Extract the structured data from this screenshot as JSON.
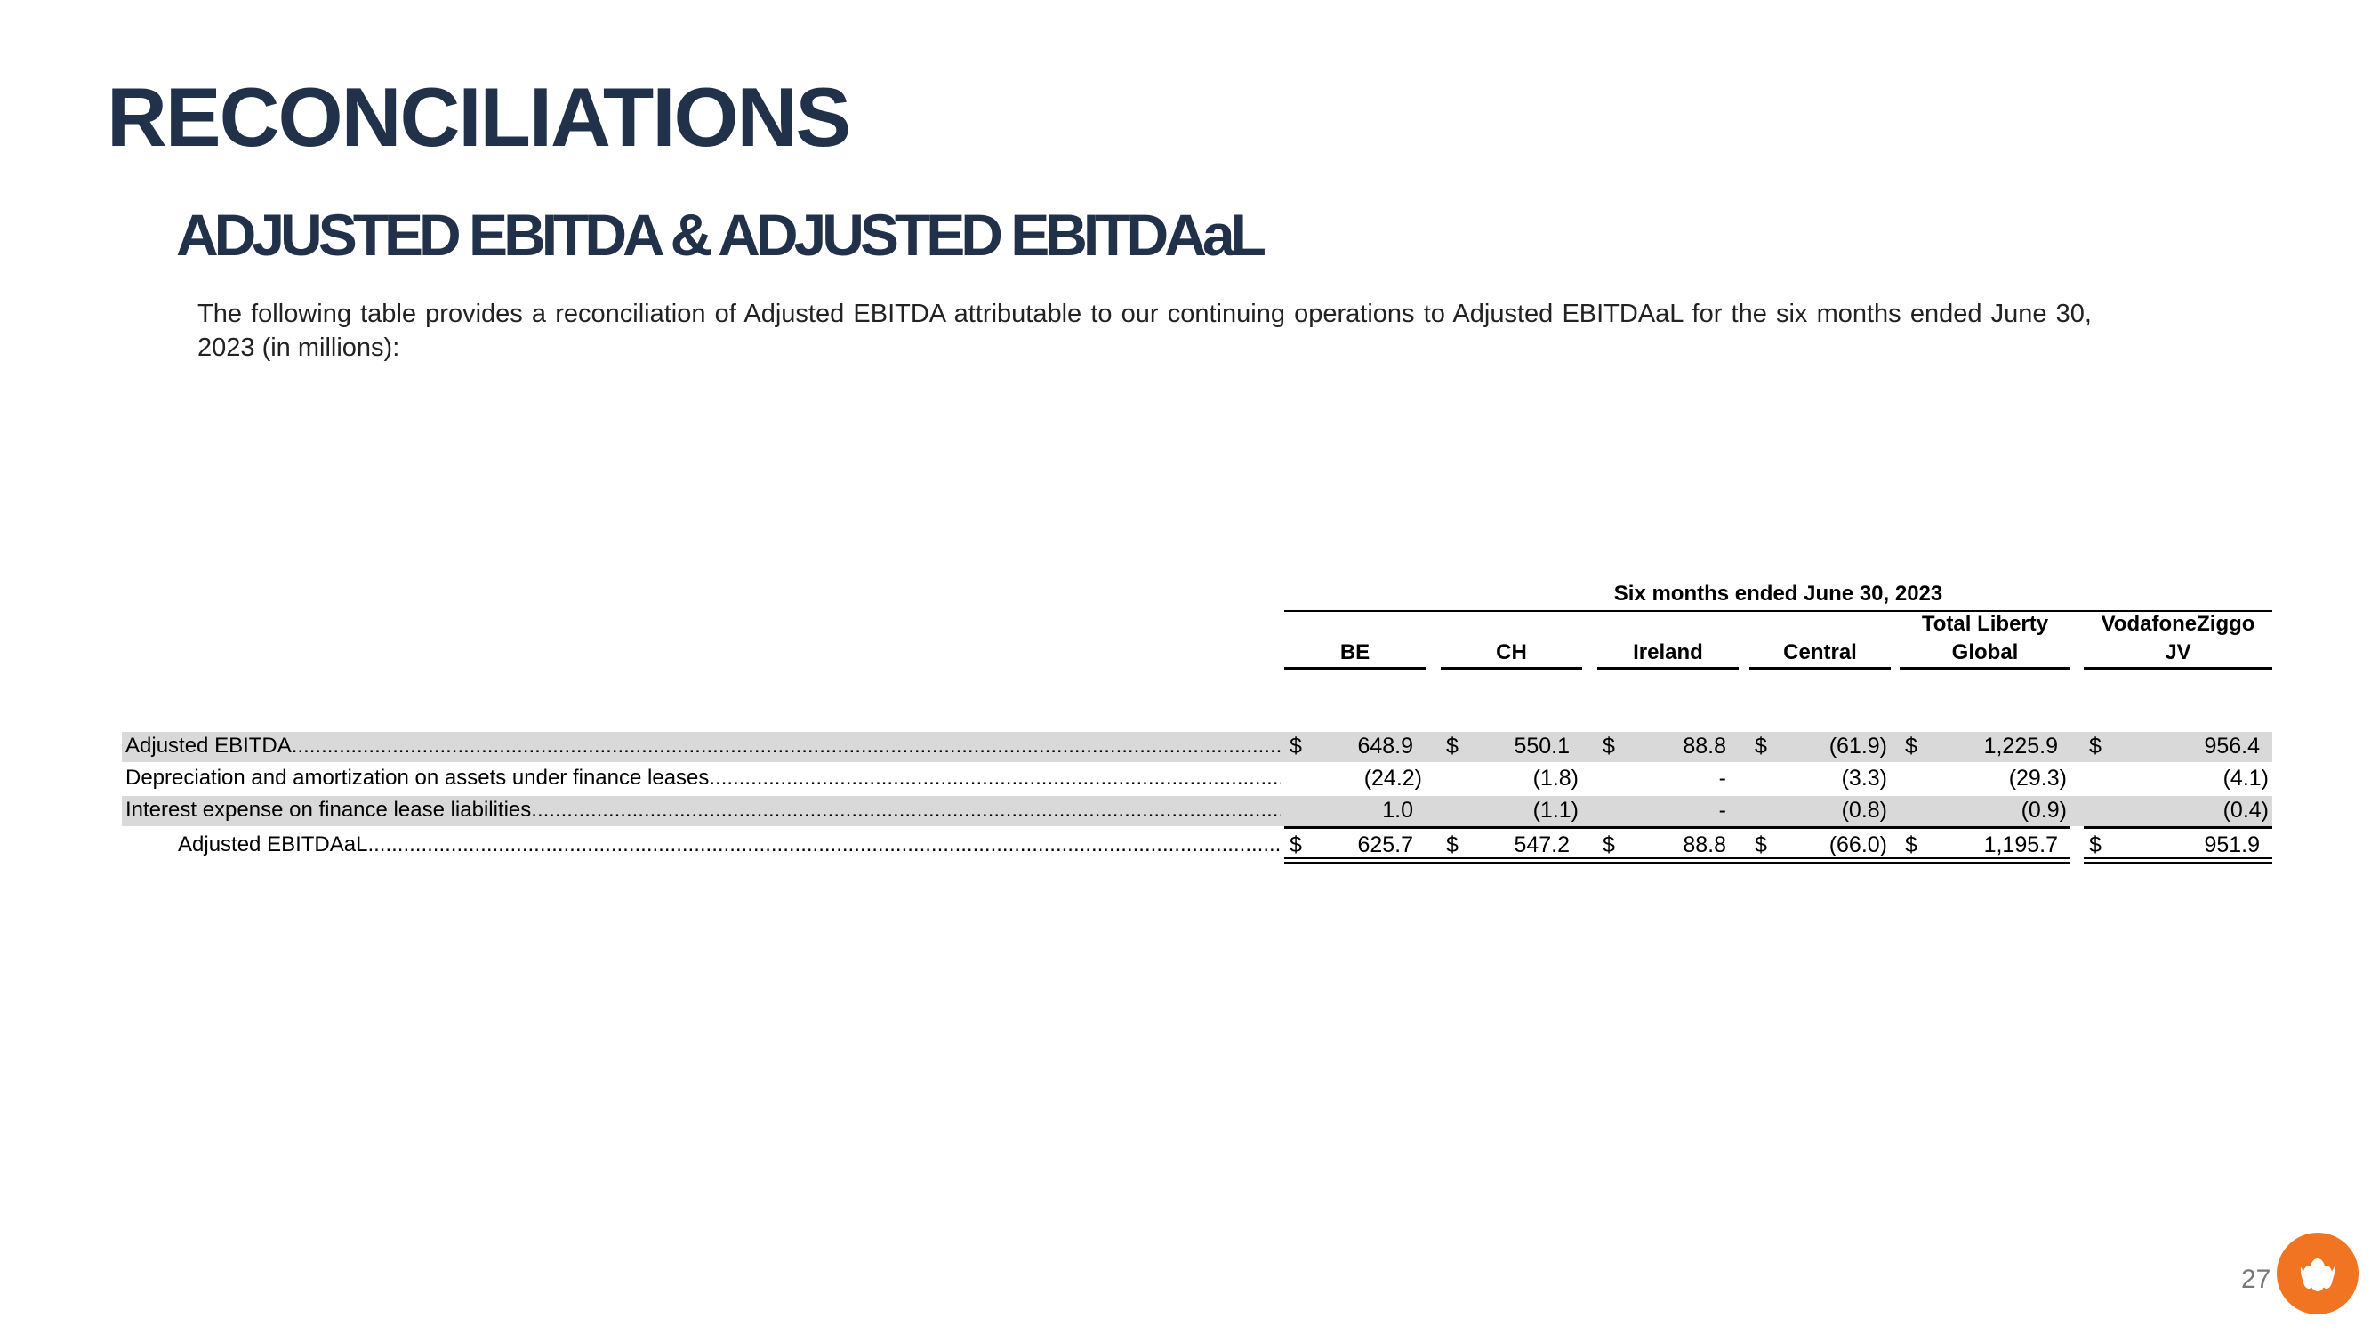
{
  "title": "RECONCILIATIONS",
  "subtitle": "ADJUSTED EBITDA & ADJUSTED EBITDAaL",
  "intro": "The following table provides a reconciliation of Adjusted EBITDA attributable to our continuing operations to Adjusted EBITDAaL for the six months ended June 30, 2023 (in millions):",
  "table": {
    "period_header": "Six months ended June 30,  2023",
    "columns": [
      {
        "line1": "",
        "line2": "BE"
      },
      {
        "line1": "",
        "line2": "CH"
      },
      {
        "line1": "",
        "line2": "Ireland"
      },
      {
        "line1": "",
        "line2": "Central"
      },
      {
        "line1": "Total Liberty",
        "line2": "Global"
      },
      {
        "line1": "VodafoneZiggo",
        "line2": "JV"
      }
    ],
    "rows": [
      {
        "label": "Adjusted EBITDA",
        "shaded": true,
        "dollar": true,
        "values": [
          "648.9",
          "550.1",
          "88.8",
          "(61.9)",
          "1,225.9",
          "956.4"
        ]
      },
      {
        "label": "Depreciation and amortization on assets under finance leases",
        "shaded": false,
        "dollar": false,
        "values": [
          "(24.2)",
          "(1.8)",
          "-",
          "(3.3)",
          "(29.3)",
          "(4.1)"
        ]
      },
      {
        "label": "Interest expense on finance lease liabilities",
        "shaded": true,
        "dollar": false,
        "values": [
          "1.0",
          "(1.1)",
          "-",
          "(0.8)",
          "(0.9)",
          "(0.4)"
        ]
      },
      {
        "label": "Adjusted EBITDAaL",
        "shaded": false,
        "dollar": true,
        "indent": true,
        "values": [
          "625.7",
          "547.2",
          "88.8",
          "(66.0)",
          "1,195.7",
          "951.9"
        ]
      }
    ],
    "currency_symbol": "$"
  },
  "footer": {
    "page_number": "27",
    "logo_icon": "liberty-global-logo-icon",
    "logo_color": "#f07422"
  },
  "colors": {
    "heading": "#22314a",
    "row_shade": "#d9d9d9"
  }
}
